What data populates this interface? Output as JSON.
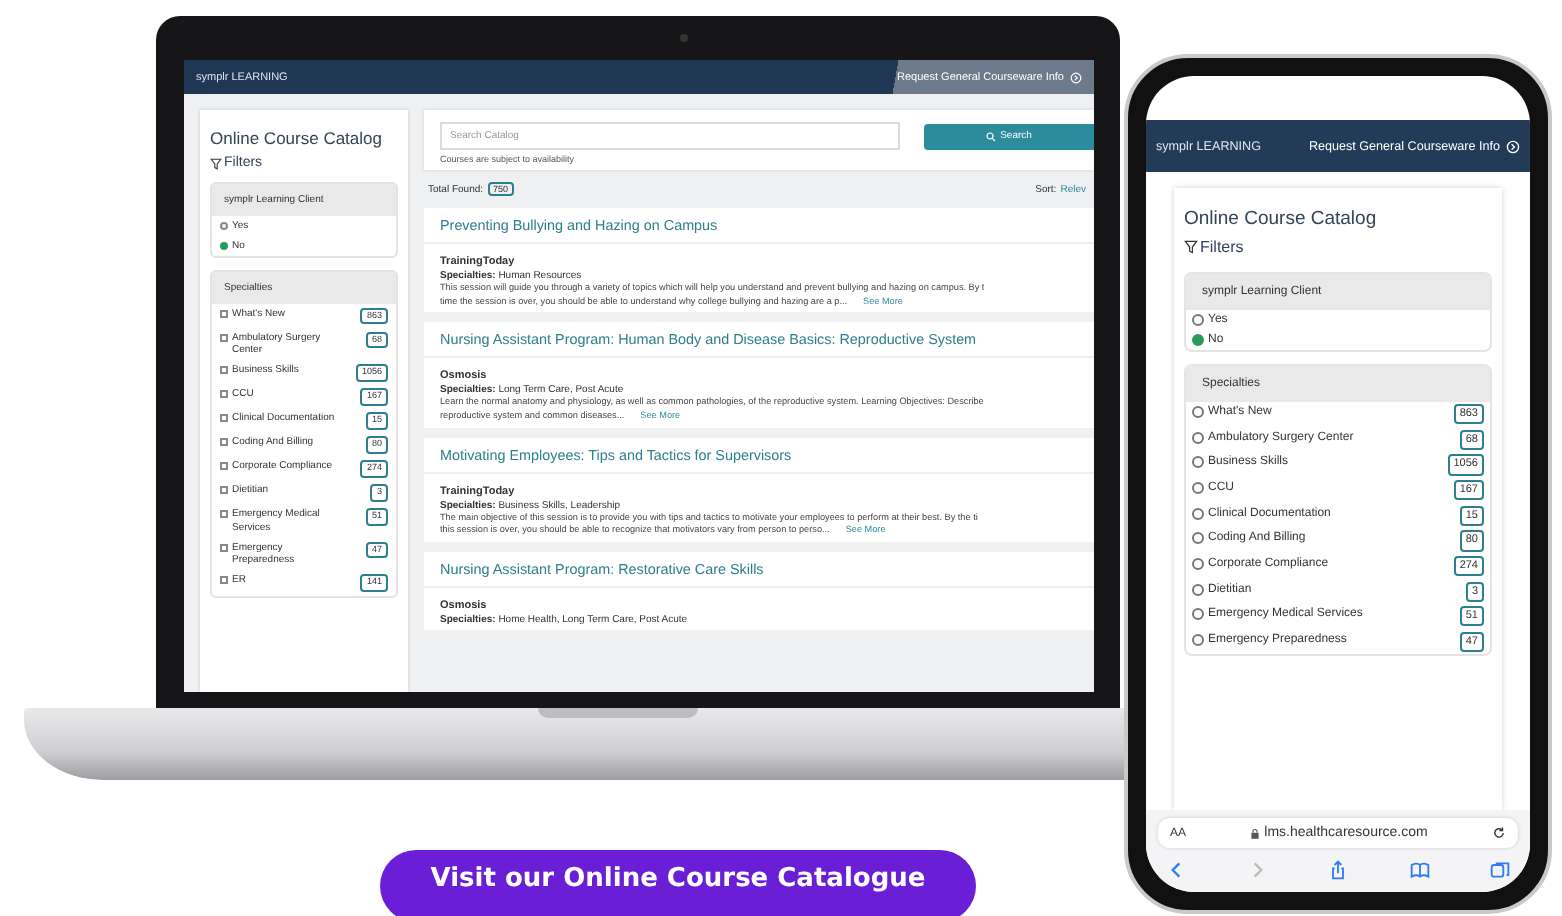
{
  "laptop_screen": {
    "logo": "symplr LEARNING",
    "header_link": "Request General Courseware Info",
    "sidebar": {
      "title": "Online Course Catalog",
      "filters_label": "Filters",
      "client_filter": {
        "title": "symplr Learning Client",
        "options": [
          {
            "label": "Yes",
            "selected": false
          },
          {
            "label": "No",
            "selected": true
          }
        ]
      },
      "specialties": {
        "title": "Specialties",
        "items": [
          {
            "label": "What's New",
            "count": "863",
            "checked": false
          },
          {
            "label": "Ambulatory Surgery Center",
            "count": "68",
            "checked": false
          },
          {
            "label": "Business Skills",
            "count": "1056",
            "checked": false
          },
          {
            "label": "CCU",
            "count": "167",
            "checked": false
          },
          {
            "label": "Clinical Documentation",
            "count": "15",
            "checked": false
          },
          {
            "label": "Coding And Billing",
            "count": "80",
            "checked": false
          },
          {
            "label": "Corporate Compliance",
            "count": "274",
            "checked": false
          },
          {
            "label": "Dietitian",
            "count": "3",
            "checked": false
          },
          {
            "label": "Emergency Medical Services",
            "count": "51",
            "checked": false
          },
          {
            "label": "Emergency Preparedness",
            "count": "47",
            "checked": false
          },
          {
            "label": "ER",
            "count": "141",
            "checked": false
          }
        ]
      }
    },
    "search": {
      "placeholder": "Search Catalog",
      "button": "Search",
      "note": "Courses are subject to availability"
    },
    "total_label": "Total Found:",
    "total": "750",
    "sort_label": "Sort:",
    "sort_value": "Relev",
    "courses": [
      {
        "title": "Preventing Bullying and Hazing on Campus",
        "provider": "TrainingToday",
        "specialties_label": "Specialties:",
        "specialties": "Human Resources",
        "description_lines": [
          "This session will guide you through a variety of topics which will help you understand and prevent bullying and hazing on campus. By t",
          "time the session is over, you should be able to understand why college bullying and hazing are a p..."
        ],
        "link": "See More"
      },
      {
        "title": "Nursing Assistant Program: Human Body and Disease Basics: Reproductive System",
        "provider": "Osmosis",
        "specialties_label": "Specialties:",
        "specialties": "Long Term Care, Post Acute",
        "description_lines": [
          "Learn the normal anatomy and physiology, as well as common pathologies, of the reproductive system. Learning Objectives: Describe",
          "reproductive system and common diseases..."
        ],
        "link": "See More"
      },
      {
        "title": "Motivating Employees: Tips and Tactics for Supervisors",
        "provider": "TrainingToday",
        "specialties_label": "Specialties:",
        "specialties": "Business Skills, Leadership",
        "description_lines": [
          "The main objective of this session is to provide you with tips and tactics to motivate your employees to perform at their best. By the ti",
          "this session is over, you should be able to recognize that motivators vary from person to perso..."
        ],
        "link": "See More"
      },
      {
        "title": "Nursing Assistant Program: Restorative Care Skills",
        "provider": "Osmosis",
        "specialties_label": "Specialties:",
        "specialties": "Home Health, Long Term Care, Post Acute"
      }
    ]
  },
  "phone_screen": {
    "logo": "symplr LEARNING",
    "header_link": "Request General Courseware Info",
    "sidebar": {
      "title": "Online Course Catalog",
      "filters_label": "Filters",
      "client_filter": {
        "title": "symplr Learning Client",
        "options": [
          {
            "label": "Yes",
            "selected": false
          },
          {
            "label": "No",
            "selected": true
          }
        ]
      },
      "specialties": {
        "title": "Specialties",
        "items": [
          {
            "label": "What's New",
            "count": "863",
            "checked": false
          },
          {
            "label": "Ambulatory Surgery Center",
            "count": "68",
            "checked": false
          },
          {
            "label": "Business Skills",
            "count": "1056",
            "checked": false
          },
          {
            "label": "CCU",
            "count": "167",
            "checked": false
          },
          {
            "label": "Clinical Documentation",
            "count": "15",
            "checked": false
          },
          {
            "label": "Coding And Billing",
            "count": "80",
            "checked": false
          },
          {
            "label": "Corporate Compliance",
            "count": "274",
            "checked": false
          },
          {
            "label": "Dietitian",
            "count": "3",
            "checked": false
          },
          {
            "label": "Emergency Medical Services",
            "count": "51",
            "checked": false
          },
          {
            "label": "Emergency Preparedness",
            "count": "47",
            "checked": false
          }
        ]
      }
    },
    "browser": {
      "text_size": "AA",
      "url": "lms.healthcaresource.com"
    }
  },
  "cta_button": "Visit our Online Course Catalogue"
}
